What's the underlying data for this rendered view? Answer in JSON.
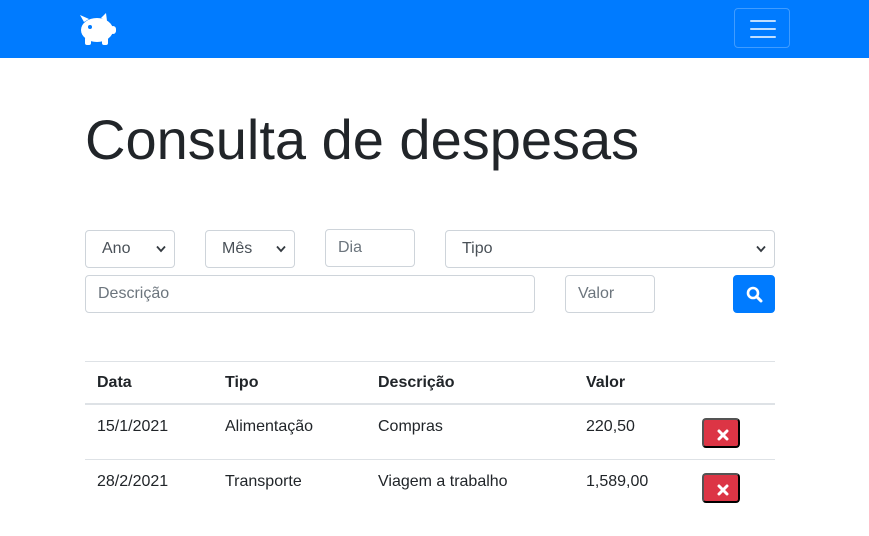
{
  "navbar": {
    "logo_icon": "piggy-bank-icon",
    "menu_icon": "hamburger-menu-icon",
    "brand_color": "#007bff"
  },
  "page": {
    "title": "Consulta de despesas"
  },
  "filters": {
    "ano": "Ano",
    "mes": "Mês",
    "dia_placeholder": "Dia",
    "tipo": "Tipo",
    "descricao_placeholder": "Descrição",
    "valor_placeholder": "Valor",
    "search_icon": "search-icon"
  },
  "table": {
    "headers": [
      "Data",
      "Tipo",
      "Descrição",
      "Valor"
    ],
    "rows": [
      {
        "data": "15/1/2021",
        "tipo": "Alimentação",
        "descricao": "Compras",
        "valor": "220,50",
        "action_icon": "close-icon"
      },
      {
        "data": "28/2/2021",
        "tipo": "Transporte",
        "descricao": "Viagem a trabalho",
        "valor": "1,589,00",
        "action_icon": "close-icon"
      }
    ]
  },
  "colors": {
    "primary": "#007bff",
    "danger": "#dc3545",
    "text": "#212529",
    "border": "#ced4da"
  }
}
